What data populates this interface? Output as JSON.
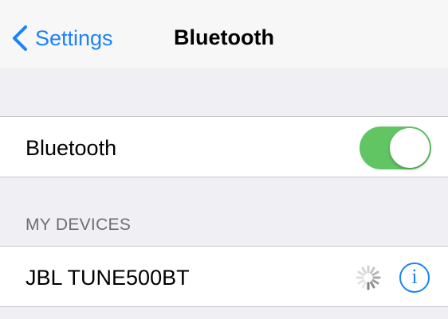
{
  "navbar": {
    "back_label": "Settings",
    "title": "Bluetooth"
  },
  "bluetooth_row": {
    "label": "Bluetooth",
    "toggle_on": true
  },
  "devices_section": {
    "header": "MY DEVICES",
    "items": [
      {
        "name": "JBL TUNE500BT",
        "status_icon": "loading-spinner-icon",
        "info_icon": "info-icon"
      }
    ]
  },
  "colors": {
    "accent": "#1a82fb",
    "toggle_on": "#62c564",
    "background": "#efeff4"
  }
}
